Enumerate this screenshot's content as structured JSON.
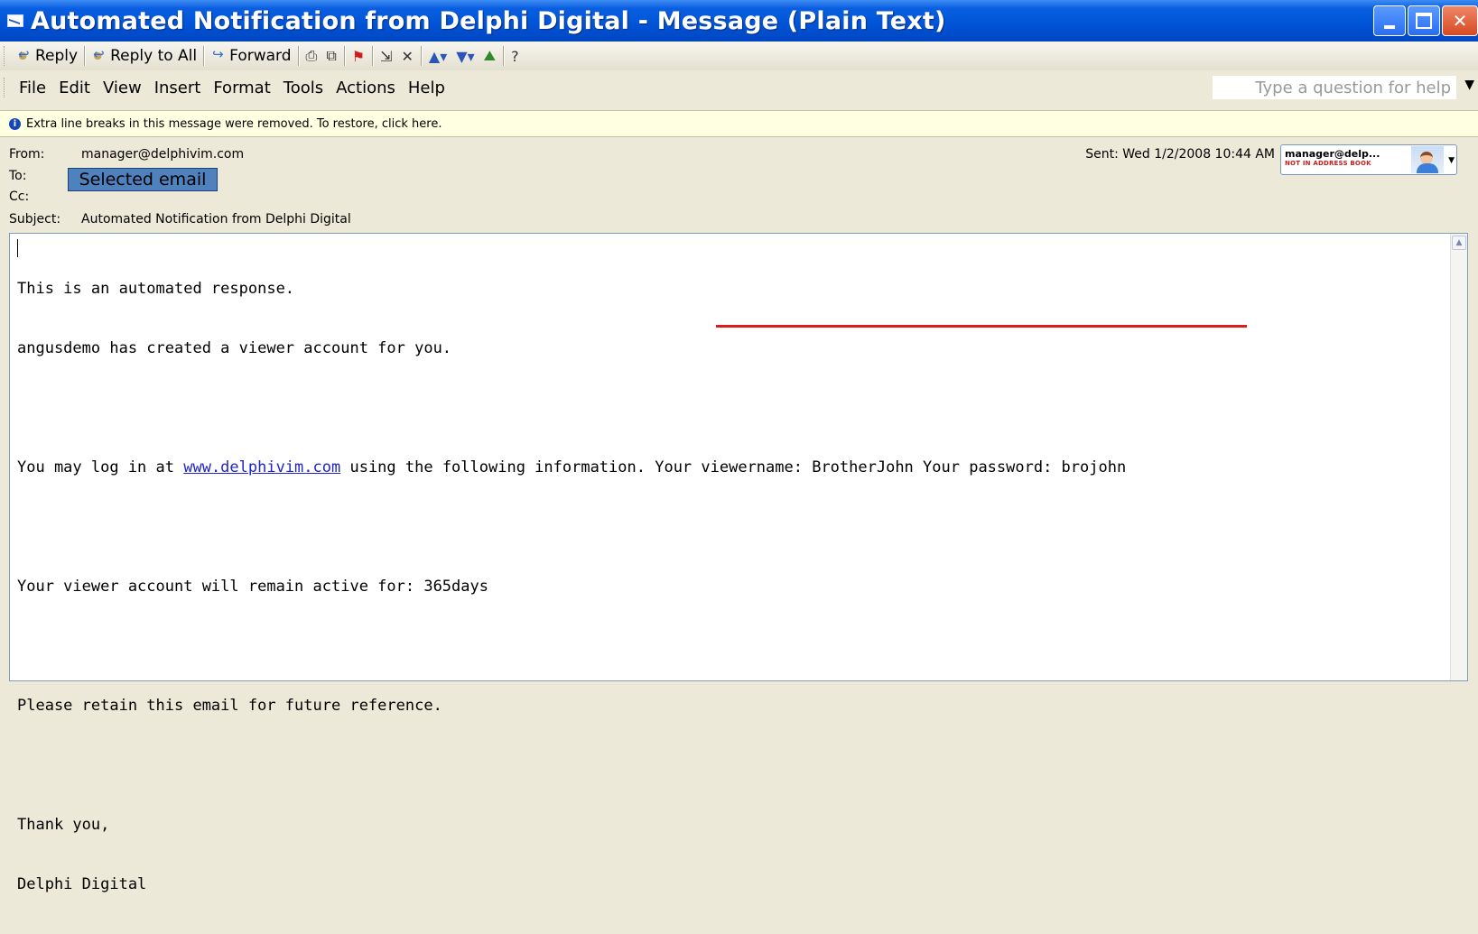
{
  "window": {
    "title": "Automated Notification from Delphi Digital - Message (Plain Text)"
  },
  "toolbar": {
    "reply": "Reply",
    "reply_all": "Reply to All",
    "forward": "Forward"
  },
  "menu": {
    "items": [
      "File",
      "Edit",
      "View",
      "Insert",
      "Format",
      "Tools",
      "Actions",
      "Help"
    ],
    "help_placeholder": "Type a question for help"
  },
  "infobar": {
    "text": "Extra line breaks in this message were removed. To restore, click here."
  },
  "header": {
    "from_label": "From:",
    "from_value": "manager@delphivim.com",
    "to_label": "To:",
    "cc_label": "Cc:",
    "subject_label": "Subject:",
    "subject_value": "Automated Notification from Delphi Digital",
    "sent_text": "Sent: Wed 1/2/2008 10:44 AM",
    "selected_email_tag": "Selected email",
    "contact_name": "manager@delp...",
    "contact_status": "NOT IN ADDRESS BOOK"
  },
  "body": {
    "line1": "This is an automated response.",
    "line2": "angusdemo has created a viewer account for you.",
    "line3_prefix": "You may log in at ",
    "line3_link": "www.delphivim.com",
    "line3_suffix": " using the following information. Your viewername: BrotherJohn Your password: brojohn",
    "line4": "Your viewer account will remain active for: 365days",
    "line5": "Please retain this email for future reference.",
    "line6": "Thank you,",
    "line7": "Delphi Digital"
  }
}
